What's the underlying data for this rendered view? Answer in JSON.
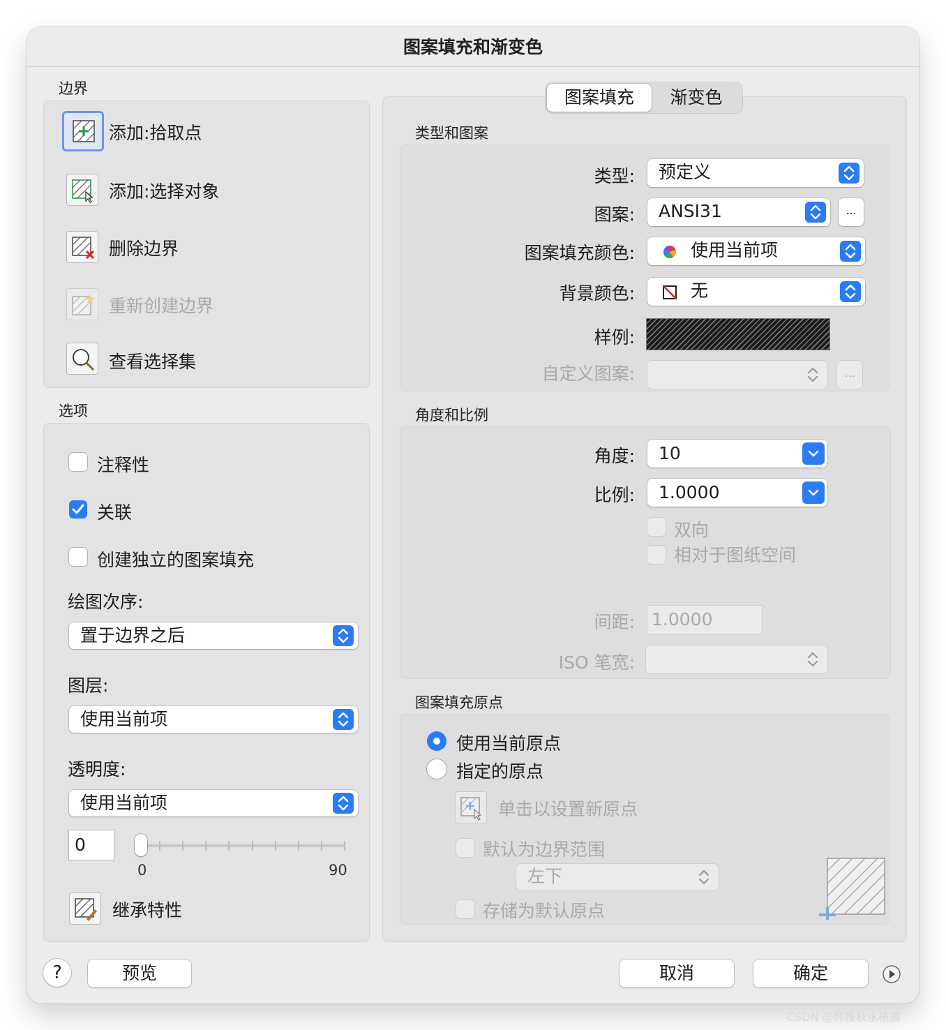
{
  "dialog": {
    "title": "图案填充和渐变色"
  },
  "boundary": {
    "label": "边界",
    "add_pick_points": "添加:拾取点",
    "add_select_objects": "添加:选择对象",
    "remove_boundaries": "删除边界",
    "recreate_boundary": "重新创建边界",
    "view_selections": "查看选择集"
  },
  "options": {
    "label": "选项",
    "annotative": "注释性",
    "associative": "关联",
    "separate_hatches": "创建独立的图案填充",
    "draw_order_label": "绘图次序:",
    "draw_order_value": "置于边界之后",
    "layer_label": "图层:",
    "layer_value": "使用当前项",
    "transparency_label": "透明度:",
    "transparency_value": "使用当前项",
    "transparency_amount": "0",
    "slider_min": "0",
    "slider_max": "90",
    "slider_level": 0,
    "inherit_properties": "继承特性"
  },
  "tabs": {
    "hatch": "图案填充",
    "gradient": "渐变色"
  },
  "type_pattern": {
    "label": "类型和图案",
    "type_label": "类型:",
    "type_value": "预定义",
    "pattern_label": "图案:",
    "pattern_value": "ANSI31",
    "ellipsis": "...",
    "color_label": "图案填充颜色:",
    "color_value": "使用当前项",
    "bg_label": "背景颜色:",
    "bg_value": "无",
    "swatch_label": "样例:",
    "custom_label": "自定义图案:"
  },
  "angle_scale": {
    "label": "角度和比例",
    "angle_label": "角度:",
    "angle_value": "10",
    "scale_label": "比例:",
    "scale_value": "1.0000",
    "double": "双向",
    "relative_paper": "相对于图纸空间",
    "spacing_label": "间距:",
    "spacing_value": "1.0000",
    "iso_label": "ISO 笔宽:"
  },
  "origin": {
    "label": "图案填充原点",
    "use_current": "使用当前原点",
    "specified": "指定的原点",
    "click_set": "单击以设置新原点",
    "default_extents": "默认为边界范围",
    "position_value": "左下",
    "store_default": "存储为默认原点"
  },
  "footer": {
    "help": "?",
    "preview": "预览",
    "cancel": "取消",
    "ok": "确定"
  },
  "watermark": "CSDN @你推秋水横晨",
  "colors": {
    "accent": "#2a7cf4",
    "panel": "#e3e3e3",
    "dialog": "#ececec"
  }
}
